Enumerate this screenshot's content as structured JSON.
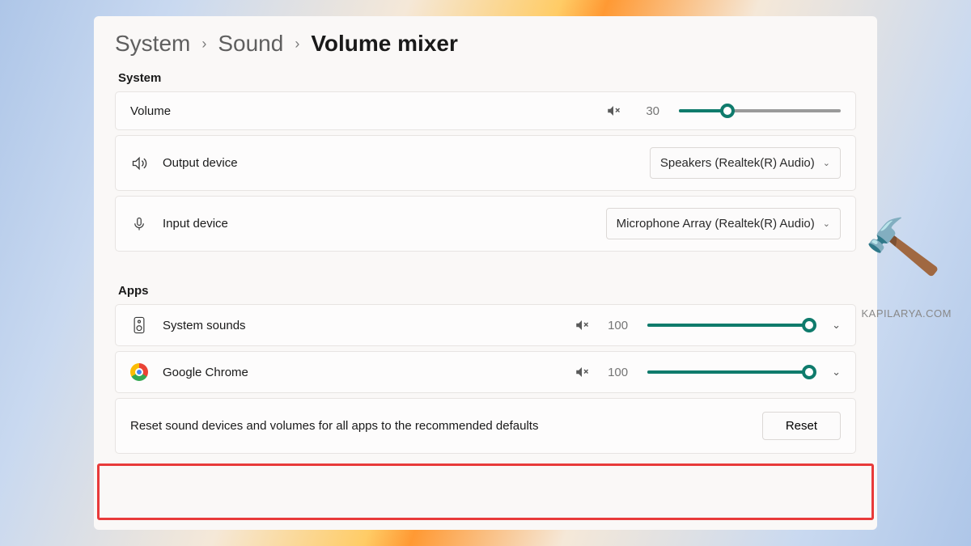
{
  "breadcrumb": {
    "level1": "System",
    "level2": "Sound",
    "current": "Volume mixer"
  },
  "sections": {
    "system_label": "System",
    "apps_label": "Apps"
  },
  "system": {
    "volume": {
      "label": "Volume",
      "value": "30",
      "percent": 30
    },
    "output": {
      "label": "Output device",
      "selected": "Speakers (Realtek(R) Audio)"
    },
    "input": {
      "label": "Input device",
      "selected": "Microphone Array (Realtek(R) Audio)"
    }
  },
  "apps": [
    {
      "label": "System sounds",
      "value": "100",
      "percent": 100,
      "icon": "speaker-device"
    },
    {
      "label": "Google Chrome",
      "value": "100",
      "percent": 100,
      "icon": "chrome"
    }
  ],
  "reset": {
    "description": "Reset sound devices and volumes for all apps to the recommended defaults",
    "button": "Reset"
  },
  "watermark": "KAPILARYA.COM"
}
